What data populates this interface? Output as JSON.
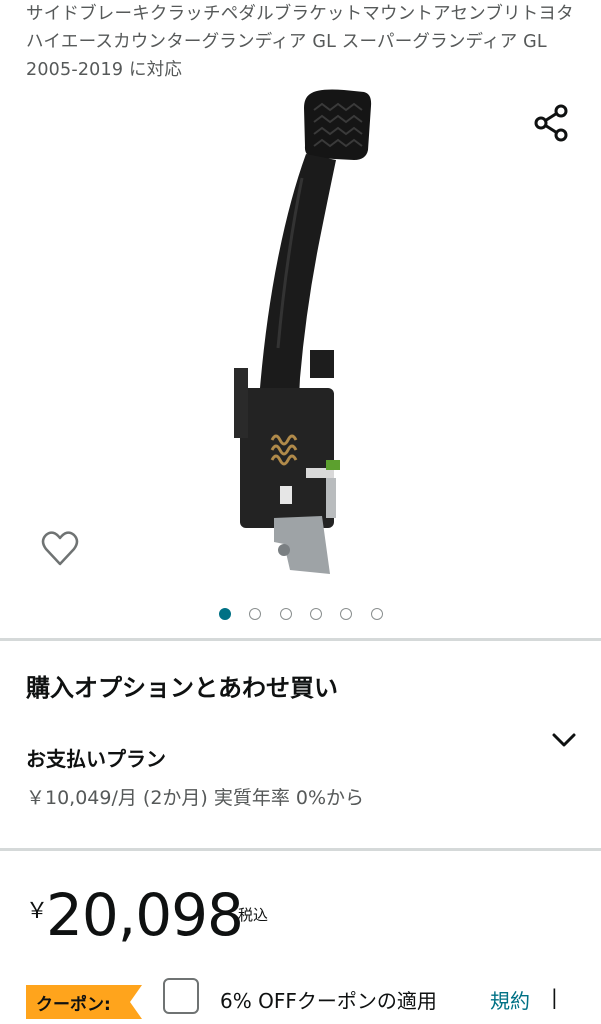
{
  "product": {
    "title": "サイドブレーキクラッチペダルブラケットマウントアセンブリトヨタハイエースカウンターグランディア GL スーパーグランディア GL 2005-2019 に対応"
  },
  "gallery": {
    "image_count": 6,
    "active_index": 0
  },
  "icons": {
    "share": "share-icon",
    "wishlist": "heart-icon",
    "expand": "chevron-down-icon"
  },
  "purchase_options": {
    "heading": "購入オプションとあわせ買い",
    "plan_title": "お支払いプラン",
    "plan_detail": "￥10,049/月 (2か月) 実質年率 0%から"
  },
  "price": {
    "currency": "￥",
    "amount": "20,098",
    "tax_label": "税込"
  },
  "coupon": {
    "badge": "クーポン:",
    "text": "6% OFFクーポンの適用",
    "terms_link": "規約",
    "separator": "|"
  },
  "colors": {
    "accent": "#007185",
    "badge": "#ffa41c",
    "muted_text": "#565959",
    "divider": "#d5d9d9"
  }
}
